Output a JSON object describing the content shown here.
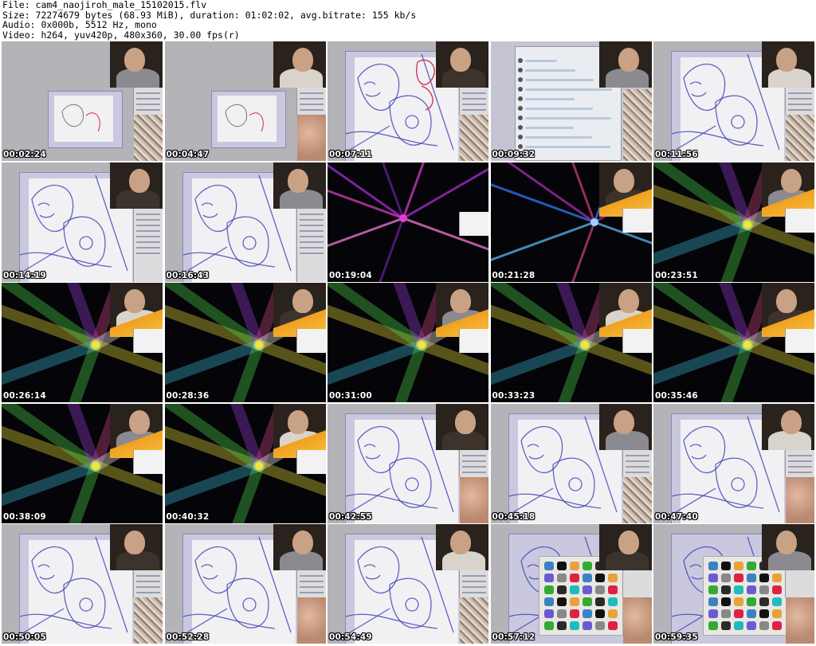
{
  "header": {
    "file_line": "File: cam4_naojiroh_male_15102015.flv",
    "size_line": "Size: 72274679 bytes (68.93 MiB), duration: 01:02:02, avg.bitrate: 155 kb/s",
    "audio_line": "Audio: 0x000b, 5512 Hz, mono",
    "video_line": "Video: h264, yuv420p, 480x360, 30.00 fps(r)"
  },
  "thumbnails": [
    {
      "time": "00:02:24",
      "scene": "drawing-zoomed-out"
    },
    {
      "time": "00:04:47",
      "scene": "drawing-zoomed-out"
    },
    {
      "time": "00:07:11",
      "scene": "drawing-red-sketch"
    },
    {
      "time": "00:09:32",
      "scene": "chat-window"
    },
    {
      "time": "00:11:56",
      "scene": "drawing-blue-lines"
    },
    {
      "time": "00:14:19",
      "scene": "drawing-blue-lines"
    },
    {
      "time": "00:16:43",
      "scene": "drawing-blue-lines"
    },
    {
      "time": "00:19:04",
      "scene": "light-burst-pink"
    },
    {
      "time": "00:21:28",
      "scene": "light-burst-blue"
    },
    {
      "time": "00:23:51",
      "scene": "light-burst-rainbow"
    },
    {
      "time": "00:26:14",
      "scene": "light-burst-rainbow"
    },
    {
      "time": "00:28:36",
      "scene": "light-burst-rainbow"
    },
    {
      "time": "00:31:00",
      "scene": "light-burst-rainbow"
    },
    {
      "time": "00:33:23",
      "scene": "light-burst-rainbow"
    },
    {
      "time": "00:35:46",
      "scene": "light-burst-rainbow"
    },
    {
      "time": "00:38:09",
      "scene": "light-burst-rainbow"
    },
    {
      "time": "00:40:32",
      "scene": "light-burst-rainbow"
    },
    {
      "time": "00:42:55",
      "scene": "drawing-blue-lines"
    },
    {
      "time": "00:45:18",
      "scene": "drawing-blue-lines"
    },
    {
      "time": "00:47:40",
      "scene": "drawing-blue-lines"
    },
    {
      "time": "00:50:05",
      "scene": "drawing-blue-lines"
    },
    {
      "time": "00:52:28",
      "scene": "drawing-blue-lines"
    },
    {
      "time": "00:54:49",
      "scene": "drawing-blue-lines"
    },
    {
      "time": "00:57:12",
      "scene": "icon-grid"
    },
    {
      "time": "00:59:35",
      "scene": "icon-grid"
    }
  ],
  "colors": {
    "sketch_blue": "#3d3fb0",
    "sketch_red": "#d02850",
    "canvas_lavender": "#c9c8de",
    "burst_yellow": "#f2e63a",
    "burst_pink": "#e040c8"
  }
}
